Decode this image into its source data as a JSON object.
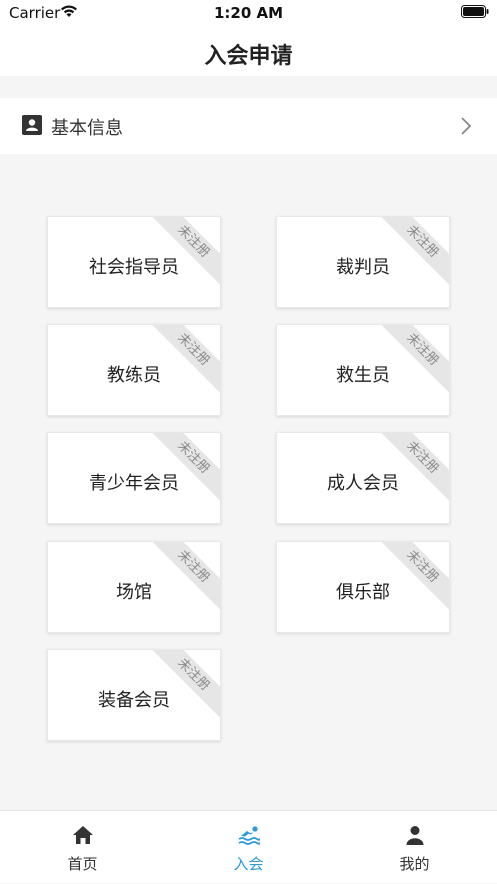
{
  "status_bar": {
    "carrier": "Carrier",
    "time": "1:20 AM"
  },
  "header": {
    "title": "入会申请"
  },
  "info_row": {
    "label": "基本信息",
    "icon": "id-card-icon"
  },
  "badge_text": "未注册",
  "cards": [
    {
      "label": "社会指导员",
      "status": "未注册"
    },
    {
      "label": "裁判员",
      "status": "未注册"
    },
    {
      "label": "教练员",
      "status": "未注册"
    },
    {
      "label": "救生员",
      "status": "未注册"
    },
    {
      "label": "青少年会员",
      "status": "未注册"
    },
    {
      "label": "成人会员",
      "status": "未注册"
    },
    {
      "label": "场馆",
      "status": "未注册"
    },
    {
      "label": "俱乐部",
      "status": "未注册"
    },
    {
      "label": "装备会员",
      "status": "未注册"
    }
  ],
  "tabs": [
    {
      "label": "首页",
      "icon": "home-icon"
    },
    {
      "label": "入会",
      "icon": "swimmer-icon",
      "active": true
    },
    {
      "label": "我的",
      "icon": "user-icon"
    }
  ],
  "colors": {
    "accent": "#2b9ad8",
    "background": "#f5f5f5",
    "ribbon": "#e6e6e6"
  }
}
